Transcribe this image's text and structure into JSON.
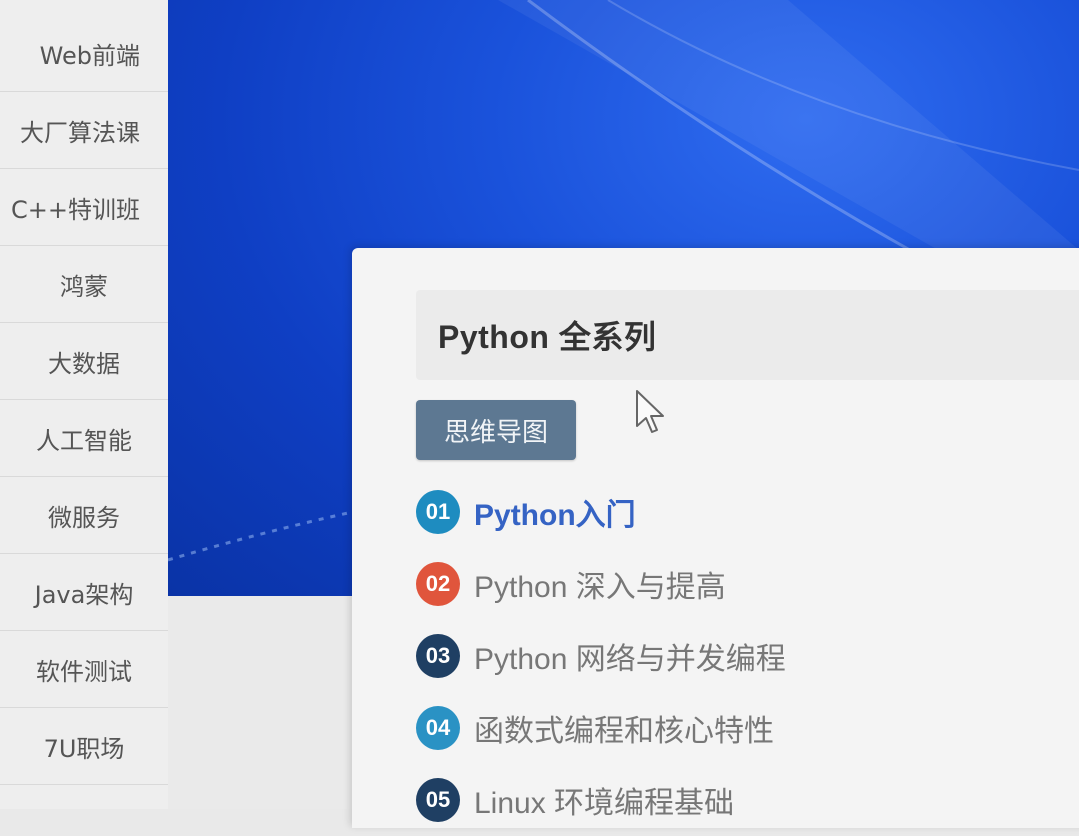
{
  "sidebar": {
    "items": [
      {
        "label": "Web前端"
      },
      {
        "label": "大厂算法课"
      },
      {
        "label": "C++特训班"
      },
      {
        "label": "鸿蒙"
      },
      {
        "label": "大数据"
      },
      {
        "label": "人工智能"
      },
      {
        "label": "微服务"
      },
      {
        "label": "Java架构"
      },
      {
        "label": "软件测试"
      },
      {
        "label": "7U职场"
      }
    ]
  },
  "card": {
    "title": "Python 全系列",
    "mindmap_button": "思维导图",
    "courses": [
      {
        "num": "01",
        "label": "Python入门",
        "color": "#1e8cc0",
        "active": true
      },
      {
        "num": "02",
        "label": "Python 深入与提高",
        "color": "#e0553c",
        "active": false
      },
      {
        "num": "03",
        "label": "Python 网络与并发编程",
        "color": "#1f3f63",
        "active": false
      },
      {
        "num": "04",
        "label": "函数式编程和核心特性",
        "color": "#2a92c4",
        "active": false
      },
      {
        "num": "05",
        "label": "Linux 环境编程基础",
        "color": "#1f3f63",
        "active": false
      }
    ]
  },
  "colors": {
    "banner_blue": "#1a52db",
    "button_bg": "#5d7892",
    "active_link": "#3563c4"
  }
}
